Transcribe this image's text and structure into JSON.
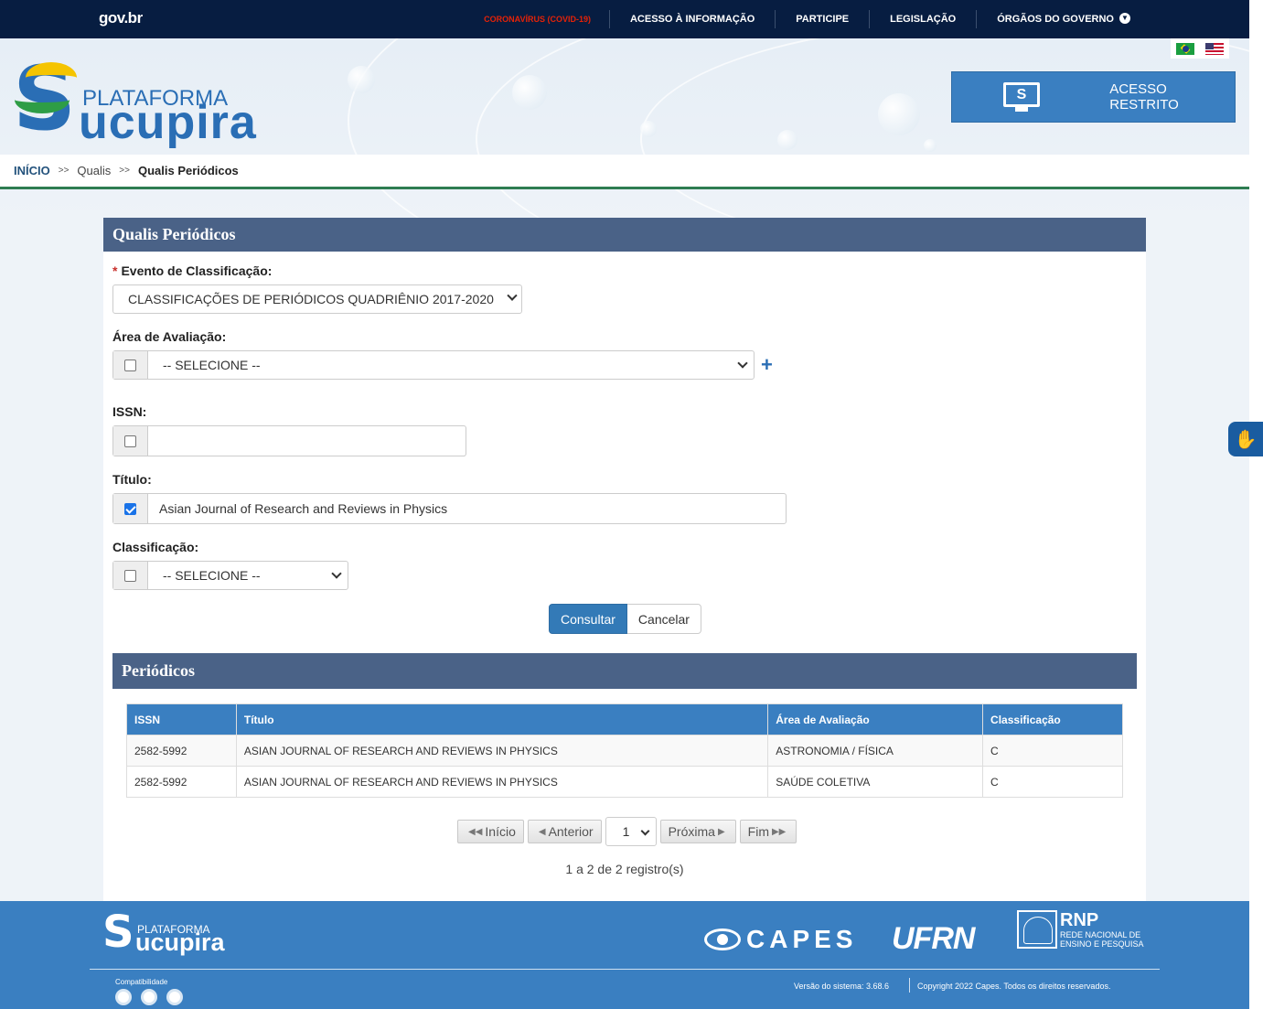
{
  "gov": {
    "logo": "gov.br",
    "nav": [
      "CORONAVÍRUS (COVID-19)",
      "ACESSO À INFORMAÇÃO",
      "PARTICIPE",
      "LEGISLAÇÃO",
      "ÓRGÃOS DO GOVERNO"
    ]
  },
  "brand": {
    "prefix": "PLATAFORMA",
    "name": "ucupira",
    "s_letter": "S"
  },
  "acesso_restrito": {
    "label": "ACESSO RESTRITO",
    "icon": "monitor-s-icon"
  },
  "breadcrumb": {
    "home": "INÍCIO",
    "separator": ">>",
    "middle": "Qualis",
    "current": "Qualis Periódicos"
  },
  "form": {
    "title": "Qualis Periódicos",
    "evento": {
      "label": "Evento de Classificação:",
      "required_mark": "*",
      "value": "CLASSIFICAÇÕES DE PERIÓDICOS QUADRIÊNIO 2017-2020"
    },
    "area": {
      "label": "Área de Avaliação:",
      "value": "-- SELECIONE --",
      "checked": false,
      "add": "+"
    },
    "issn": {
      "label": "ISSN:",
      "value": "",
      "checked": false
    },
    "titulo": {
      "label": "Título:",
      "value": "Asian Journal of Research and Reviews in Physics",
      "checked": true
    },
    "classificacao": {
      "label": "Classificação:",
      "value": "-- SELECIONE --",
      "checked": false
    },
    "consultar": "Consultar",
    "cancelar": "Cancelar"
  },
  "results": {
    "title": "Periódicos",
    "columns": [
      "ISSN",
      "Título",
      "Área de Avaliação",
      "Classificação"
    ],
    "rows": [
      [
        "2582-5992",
        "ASIAN JOURNAL OF RESEARCH AND REVIEWS IN PHYSICS",
        "ASTRONOMIA / FÍSICA",
        "C"
      ],
      [
        "2582-5992",
        "ASIAN JOURNAL OF RESEARCH AND REVIEWS IN PHYSICS",
        "SAÚDE COLETIVA",
        "C"
      ]
    ],
    "pager": {
      "first": "Início",
      "prev": "Anterior",
      "page": "1",
      "next": "Próxima",
      "last": "Fim"
    },
    "count": "1 a 2 de 2 registro(s)"
  },
  "footer": {
    "brand_prefix": "PLATAFORMA",
    "brand_name": "ucupira",
    "s_letter": "S",
    "capes": "CAPES",
    "ufrn": "UFRN",
    "rnp": "RNP",
    "rnp_line1": "REDE NACIONAL DE",
    "rnp_line2": "ENSINO E PESQUISA",
    "compat": "Compatibilidade",
    "version": "Versão do sistema: 3.68.6",
    "copyright": "Copyright 2022 Capes. Todos os direitos reservados."
  },
  "colors": {
    "gov_bar": "#071d41",
    "header_blue": "#4a6287",
    "accent": "#3a7fc1",
    "covid_red": "#e52207"
  }
}
